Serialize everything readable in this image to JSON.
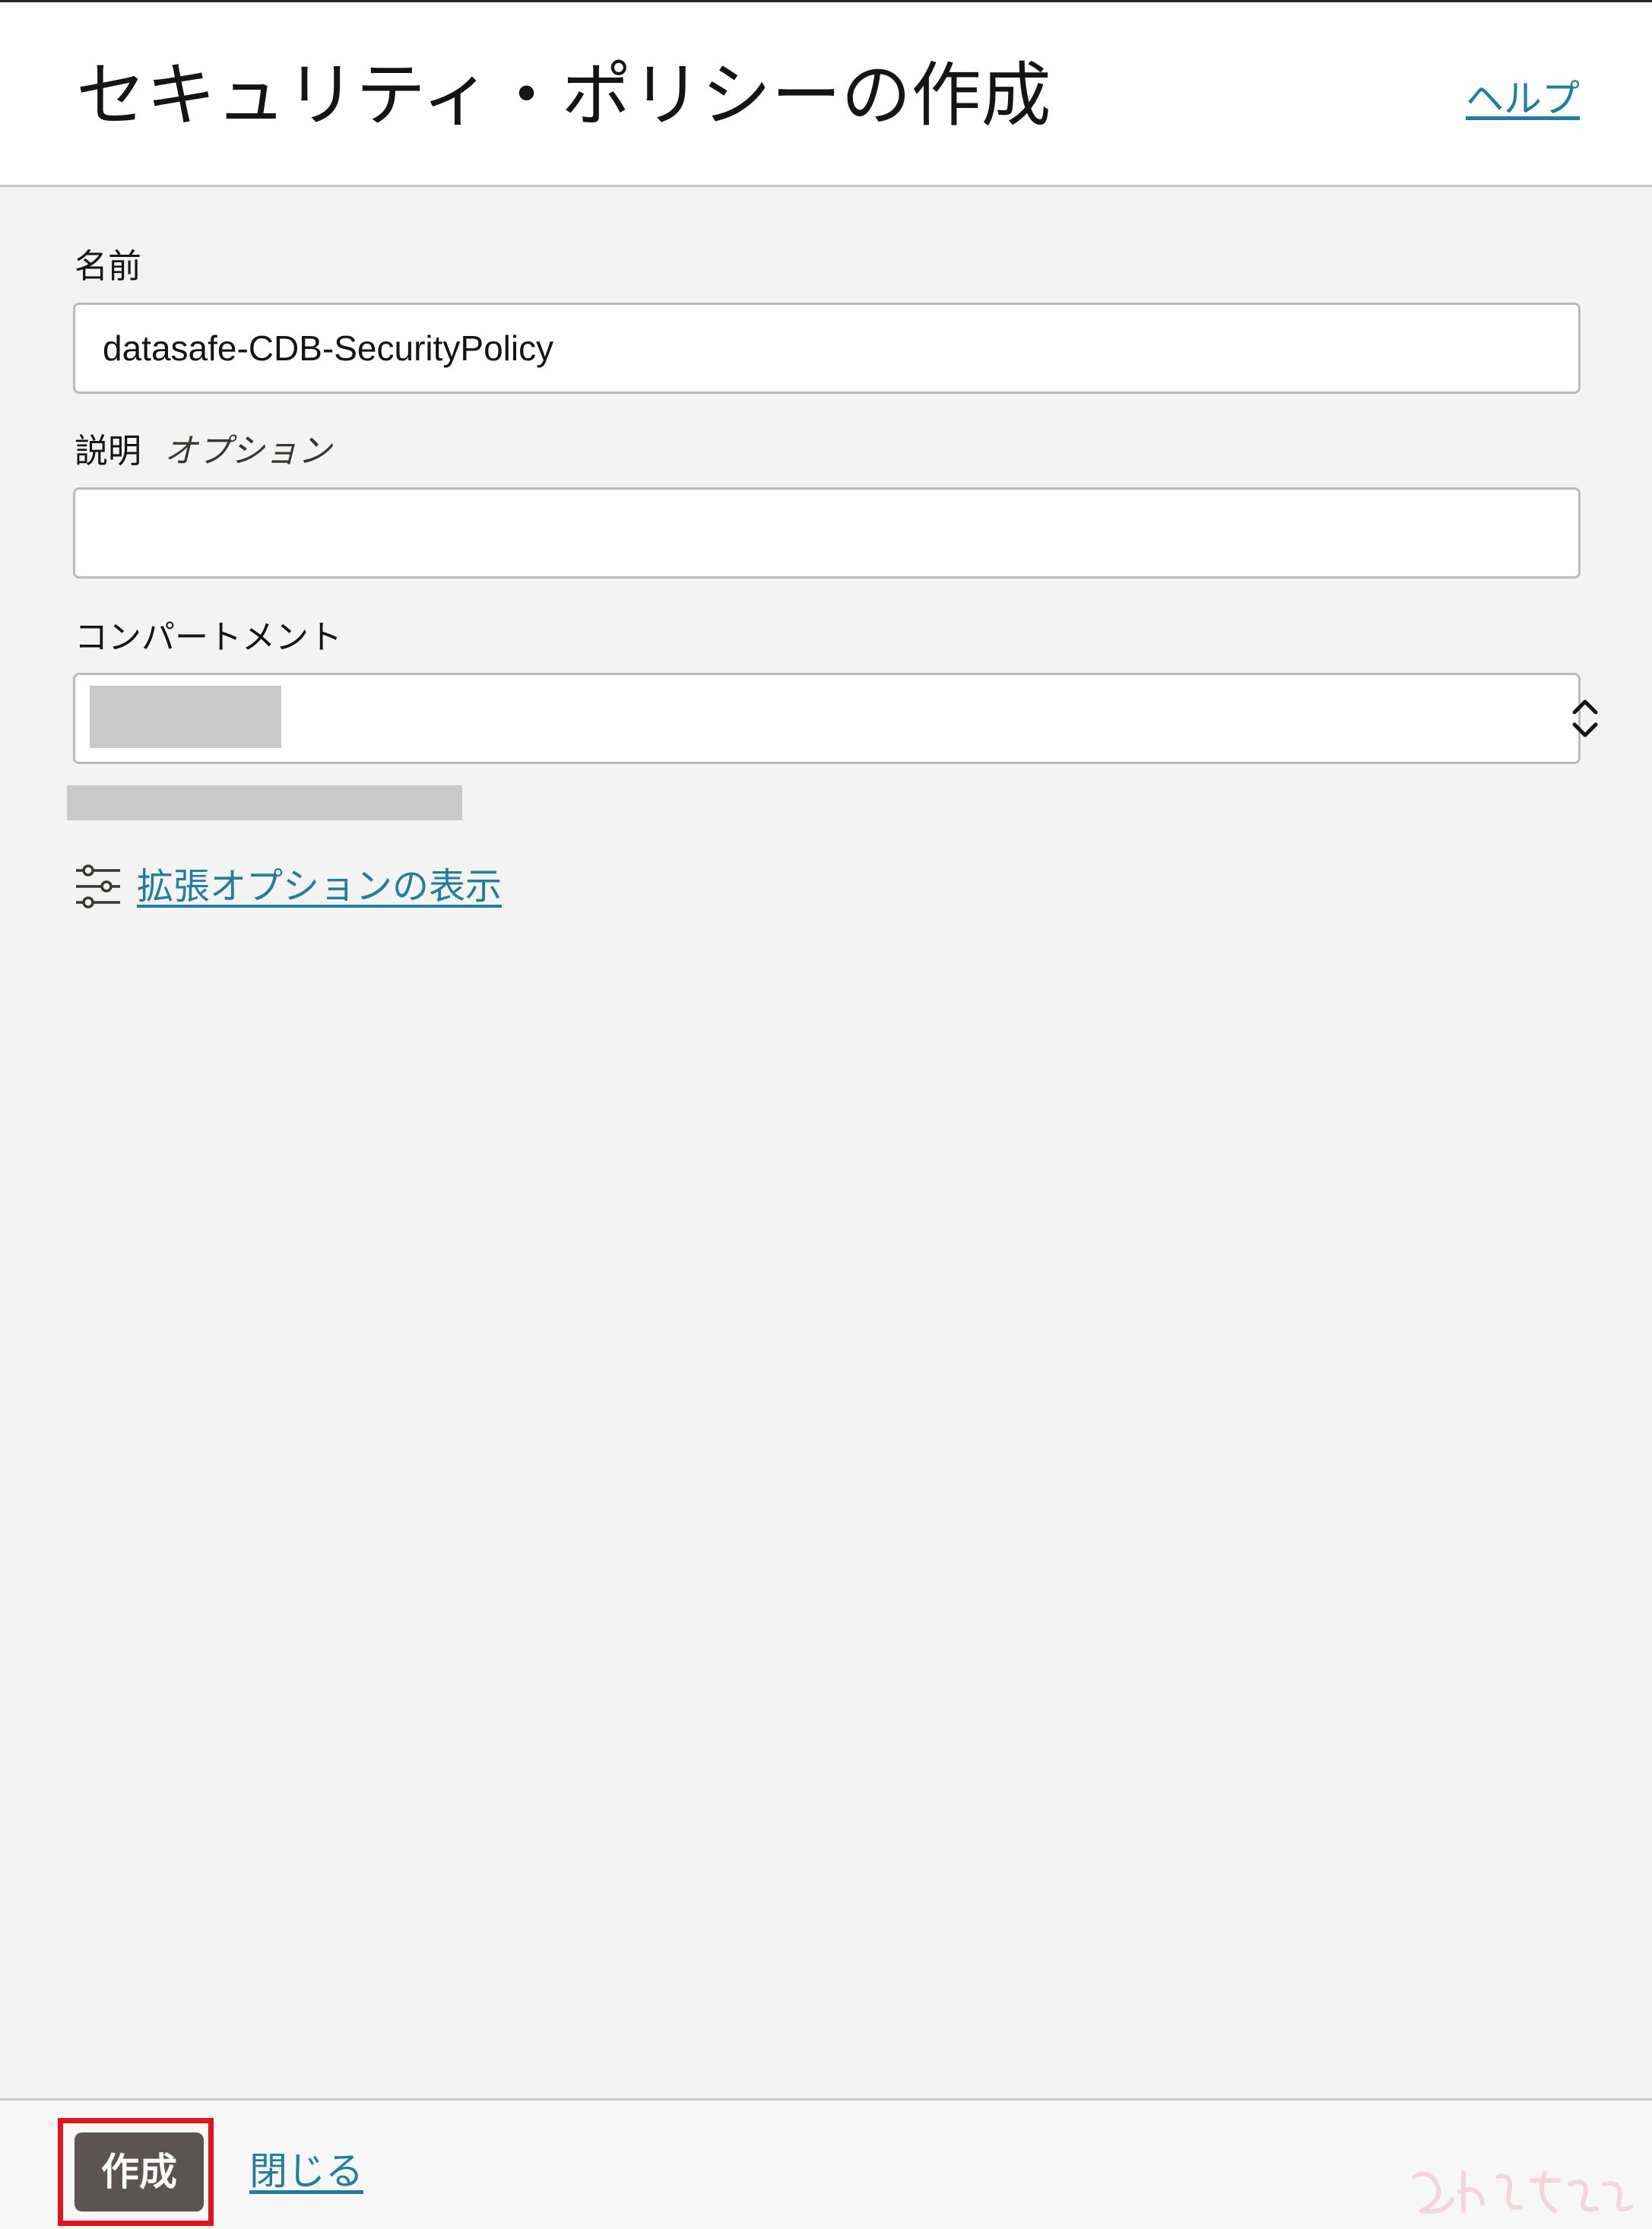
{
  "header": {
    "title": "セキュリティ・ポリシーの作成",
    "help_label": "ヘルプ"
  },
  "form": {
    "name": {
      "label": "名前",
      "value": "datasafe-CDB-SecurityPolicy"
    },
    "description": {
      "label": "説明",
      "optional_label": "オプション",
      "value": ""
    },
    "compartment": {
      "label": "コンパートメント",
      "icon": "chevron-up-down-icon"
    },
    "advanced_options": {
      "icon": "sliders-icon",
      "label": "拡張オプションの表示"
    }
  },
  "footer": {
    "create_label": "作成",
    "close_label": "閉じる"
  },
  "colors": {
    "link": "#227e9e",
    "primary_button": "#5b5452",
    "highlight": "#e1141c",
    "background": "#f3f3f3"
  }
}
